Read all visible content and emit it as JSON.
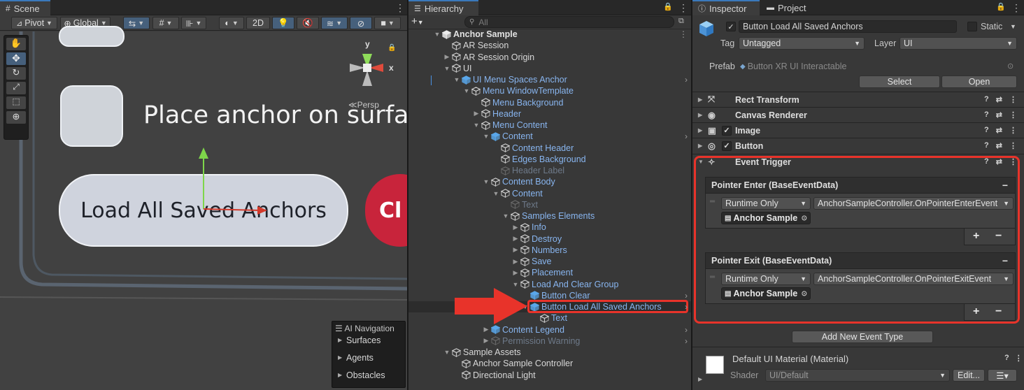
{
  "scene": {
    "tab_label": "Scene",
    "pivot_label": "Pivot",
    "global_label": "Global",
    "mode_2d": "2D",
    "gizmo_y": "y",
    "gizmo_x": "x",
    "persp_label": "≪Persp",
    "canvas_text": "Place anchor on surface",
    "button_label": "Load All Saved Anchors",
    "clear_label": "Cl",
    "overlay": {
      "title": "AI Navigation",
      "items": [
        "Surfaces",
        "Agents",
        "Obstacles"
      ]
    }
  },
  "hierarchy": {
    "tab_label": "Hierarchy",
    "search_placeholder": "All",
    "rows": [
      {
        "label": "Anchor Sample",
        "style": "bold"
      },
      {
        "label": "AR Session",
        "style": "white"
      },
      {
        "label": "AR Session Origin",
        "style": "white"
      },
      {
        "label": "UI",
        "style": "white"
      },
      {
        "label": "UI Menu Spaces Anchor",
        "style": "blue"
      },
      {
        "label": "Menu WindowTemplate",
        "style": "blue"
      },
      {
        "label": "Menu Background",
        "style": "blue"
      },
      {
        "label": "Header",
        "style": "blue"
      },
      {
        "label": "Menu Content",
        "style": "blue"
      },
      {
        "label": "Content",
        "style": "blue"
      },
      {
        "label": "Content Header",
        "style": "blue"
      },
      {
        "label": "Edges Background",
        "style": "blue"
      },
      {
        "label": "Header Label",
        "style": "dim"
      },
      {
        "label": "Content Body",
        "style": "blue"
      },
      {
        "label": "Content",
        "style": "blue"
      },
      {
        "label": "Text",
        "style": "dim"
      },
      {
        "label": "Samples Elements",
        "style": "blue"
      },
      {
        "label": "Info",
        "style": "blue"
      },
      {
        "label": "Destroy",
        "style": "blue"
      },
      {
        "label": "Numbers",
        "style": "blue"
      },
      {
        "label": "Save",
        "style": "blue"
      },
      {
        "label": "Placement",
        "style": "blue"
      },
      {
        "label": "Load And Clear Group",
        "style": "blue"
      },
      {
        "label": "Button Clear",
        "style": "blue"
      },
      {
        "label": "Button Load All Saved Anchors",
        "style": "blue"
      },
      {
        "label": "Text",
        "style": "blue"
      },
      {
        "label": "Content Legend",
        "style": "blue"
      },
      {
        "label": "Permission Warning",
        "style": "dim"
      },
      {
        "label": "Sample Assets",
        "style": "white"
      },
      {
        "label": "Anchor Sample Controller",
        "style": "white"
      },
      {
        "label": "Directional Light",
        "style": "white"
      }
    ]
  },
  "inspector": {
    "tab_inspector": "Inspector",
    "tab_project": "Project",
    "object_name": "Button Load All Saved Anchors",
    "static_label": "Static",
    "tag_label": "Tag",
    "tag_value": "Untagged",
    "layer_label": "Layer",
    "layer_value": "UI",
    "prefab_label": "Prefab",
    "prefab_value": "Button XR UI Interactable",
    "select_label": "Select",
    "open_label": "Open",
    "components": [
      "Rect Transform",
      "Canvas Renderer",
      "Image",
      "Button",
      "Event Trigger"
    ],
    "events": [
      {
        "title": "Pointer Enter (BaseEventData)",
        "mode": "Runtime Only",
        "function": "AnchorSampleController.OnPointerEnterEvent",
        "target": "Anchor Sample"
      },
      {
        "title": "Pointer Exit (BaseEventData)",
        "mode": "Runtime Only",
        "function": "AnchorSampleController.OnPointerExitEvent",
        "target": "Anchor Sample"
      }
    ],
    "add_event_label": "Add New Event Type",
    "material_name": "Default UI Material (Material)",
    "shader_label": "Shader",
    "shader_value": "UI/Default",
    "edit_label": "Edit..."
  },
  "colors": {
    "highlight": "#e8332a",
    "selection": "#46607c",
    "link_blue": "#88b5ef"
  }
}
